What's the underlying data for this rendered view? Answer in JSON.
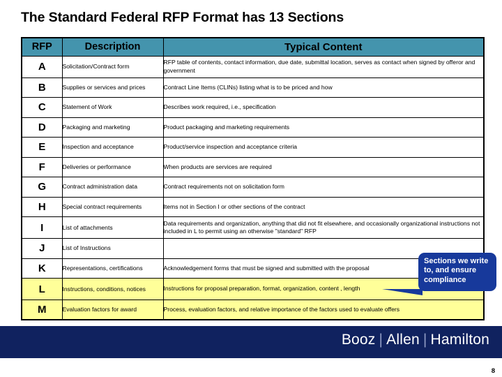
{
  "slide": {
    "title": "The Standard Federal RFP Format has 13 Sections",
    "page_number": "8"
  },
  "table": {
    "headers": {
      "rfp": "RFP",
      "description": "Description",
      "typical_content": "Typical Content"
    },
    "header_bg": "#4494ad",
    "highlight_bg": "#ffff99",
    "rows": [
      {
        "letter": "A",
        "description": "Solicitation/Contract form",
        "content": "RFP table of contents, contact information, due date, submittal location, serves as contact when signed by offeror and government",
        "highlight": false
      },
      {
        "letter": "B",
        "description": "Supplies or services and prices",
        "content": "Contract Line Items (CLINs) listing what is to be priced and how",
        "highlight": false
      },
      {
        "letter": "C",
        "description": "Statement of Work",
        "content": "Describes work required, i.e., specification",
        "highlight": false
      },
      {
        "letter": "D",
        "description": "Packaging and marketing",
        "content": "Product packaging and marketing requirements",
        "highlight": false
      },
      {
        "letter": "E",
        "description": "Inspection and acceptance",
        "content": "Product/service inspection and acceptance criteria",
        "highlight": false
      },
      {
        "letter": "F",
        "description": "Deliveries or performance",
        "content": "When products are services are required",
        "highlight": false
      },
      {
        "letter": "G",
        "description": "Contract administration data",
        "content": "Contract requirements not on solicitation form",
        "highlight": false
      },
      {
        "letter": "H",
        "description": "Special contract requirements",
        "content": "Items not in Section I or other sections of the contract",
        "highlight": false
      },
      {
        "letter": "I",
        "description": "List of attachments",
        "content": "Data requirements and organization, anything that did not fit elsewhere, and occasionally organizational instructions not included in L to permit using an otherwise \"standard\" RFP",
        "highlight": false
      },
      {
        "letter": "J",
        "description": "List of Instructions",
        "content": "",
        "highlight": false
      },
      {
        "letter": "K",
        "description": "Representations, certifications",
        "content": "Acknowledgement forms that must be signed and submitted with the proposal",
        "highlight": false
      },
      {
        "letter": "L",
        "description": "Instructions, conditions, notices",
        "content": "Instructions for proposal preparation, format, organization, content , length",
        "highlight": true
      },
      {
        "letter": "M",
        "description": "Evaluation factors for award",
        "content": "Process, evaluation factors, and relative importance of the factors used to evaluate offers",
        "highlight": true
      }
    ]
  },
  "callout": {
    "text": "Sections we write to, and ensure compliance",
    "bg_color": "#17399b",
    "text_color": "#ffffff"
  },
  "footer": {
    "brand_1": "Booz",
    "brand_2": "Allen",
    "brand_3": "Hamilton",
    "separator": "|",
    "bg_color": "#10225f"
  }
}
